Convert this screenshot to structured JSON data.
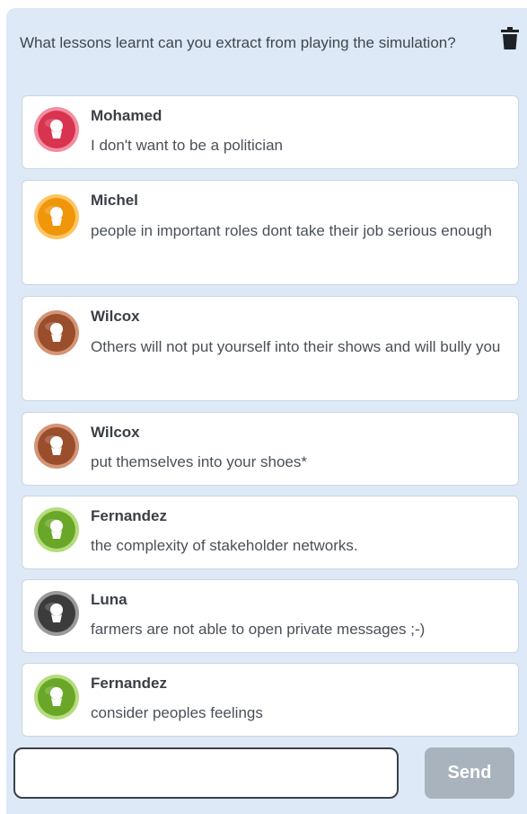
{
  "question": "What lessons learnt can you extract from playing the simulation?",
  "delete_icon": "trash-icon",
  "messages": [
    {
      "author": "Mohamed",
      "text": "I don't want to be a politician",
      "avatar_color": "#d8344f",
      "avatar_ring": "#f28ea0"
    },
    {
      "author": "Michel",
      "text": "people in important roles dont take their job serious enough",
      "avatar_color": "#f0960a",
      "avatar_ring": "#ffc562"
    },
    {
      "author": "Wilcox",
      "text": "Others will not put yourself into their shows and will bully you",
      "avatar_color": "#9a4e2c",
      "avatar_ring": "#d49476"
    },
    {
      "author": "Wilcox",
      "text": "put themselves into your shoes*",
      "avatar_color": "#9a4e2c",
      "avatar_ring": "#d49476"
    },
    {
      "author": "Fernandez",
      "text": "the complexity of stakeholder networks.",
      "avatar_color": "#6aa728",
      "avatar_ring": "#b5dc7e"
    },
    {
      "author": "Luna",
      "text": "farmers are not able to open private messages ;-)",
      "avatar_color": "#3c3c3c",
      "avatar_ring": "#9a9a9a"
    },
    {
      "author": "Fernandez",
      "text": "consider peoples feelings",
      "avatar_color": "#6aa728",
      "avatar_ring": "#b5dc7e"
    }
  ],
  "composer": {
    "input_value": "",
    "send_label": "Send"
  }
}
